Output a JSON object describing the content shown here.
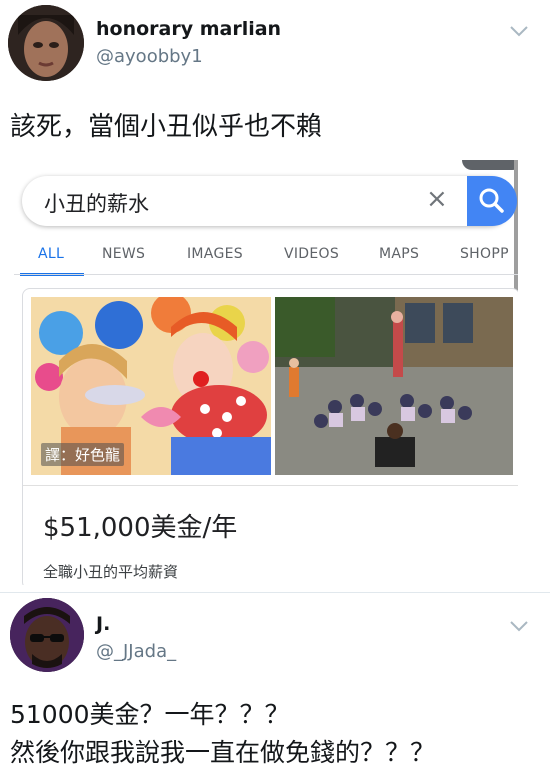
{
  "tweet1": {
    "name": "honorary marlian",
    "handle": "@ayoobby1",
    "text": "該死，當個小丑似乎也不賴",
    "embed": {
      "search_query": "小丑的薪水",
      "tabs": [
        {
          "label": "ALL",
          "active": true
        },
        {
          "label": "NEWS",
          "active": false
        },
        {
          "label": "IMAGES",
          "active": false
        },
        {
          "label": "VIDEOS",
          "active": false
        },
        {
          "label": "MAPS",
          "active": false
        },
        {
          "label": "SHOPP",
          "active": false
        }
      ],
      "watermark": "譯：好色龍",
      "salary": "$51,000美金/年",
      "salary_caption": "全職小丑的平均薪資"
    }
  },
  "tweet2": {
    "name": "J.",
    "handle": "@_JJada_",
    "text_lines": [
      "51000美金？一年？？？",
      "然後你跟我說我一直在做免錢的？？？"
    ]
  },
  "colors": {
    "accent_blue": "#1a73e8",
    "search_button": "#4285f4",
    "handle_gray": "#657786"
  }
}
